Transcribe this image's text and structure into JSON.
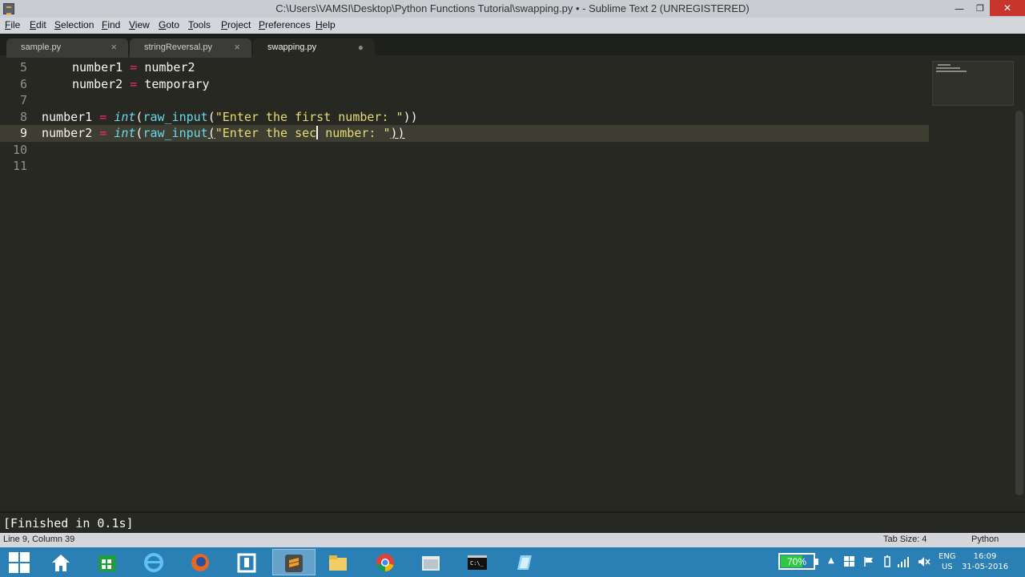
{
  "window": {
    "title": "C:\\Users\\VAMSI\\Desktop\\Python Functions Tutorial\\swapping.py • - Sublime Text 2 (UNREGISTERED)",
    "min_glyph": "—",
    "max_glyph": "❐",
    "close_glyph": "✕"
  },
  "menu": [
    "File",
    "Edit",
    "Selection",
    "Find",
    "View",
    "Goto",
    "Tools",
    "Project",
    "Preferences",
    "Help"
  ],
  "tabs": [
    {
      "label": "sample.py",
      "close": "×"
    },
    {
      "label": "stringReversal.py",
      "close": "×"
    },
    {
      "label": "swapping.py",
      "close": "●"
    }
  ],
  "editor": {
    "line_numbers": [
      "5",
      "6",
      "7",
      "8",
      "9",
      "10",
      "11"
    ],
    "line5": {
      "lhs": "number1",
      "op": "=",
      "rhs": "number2"
    },
    "line6": {
      "lhs": "number2",
      "op": "=",
      "rhs": "temporary"
    },
    "line8": {
      "lhs": "number1",
      "op": "=",
      "fn": "int",
      "p1": "(",
      "call": "raw_input",
      "p2": "(",
      "str": "\"Enter the first number: \"",
      "close": "))"
    },
    "line9": {
      "lhs": "number2",
      "op": "=",
      "fn": "int",
      "p1": "(",
      "call": "raw_input",
      "p2": "(",
      "str_a": "\"Enter the sec",
      "str_b": " number: \"",
      "close": "))"
    }
  },
  "output": {
    "text": "[Finished in 0.1s]"
  },
  "status": {
    "position": "Line 9, Column 39",
    "tab_size": "Tab Size: 4",
    "syntax": "Python"
  },
  "taskbar": {
    "battery": "70%",
    "battery_level": 0.7,
    "lang_top": "ENG",
    "lang_bottom": "US",
    "time": "16:09",
    "date": "31-05-2016"
  }
}
